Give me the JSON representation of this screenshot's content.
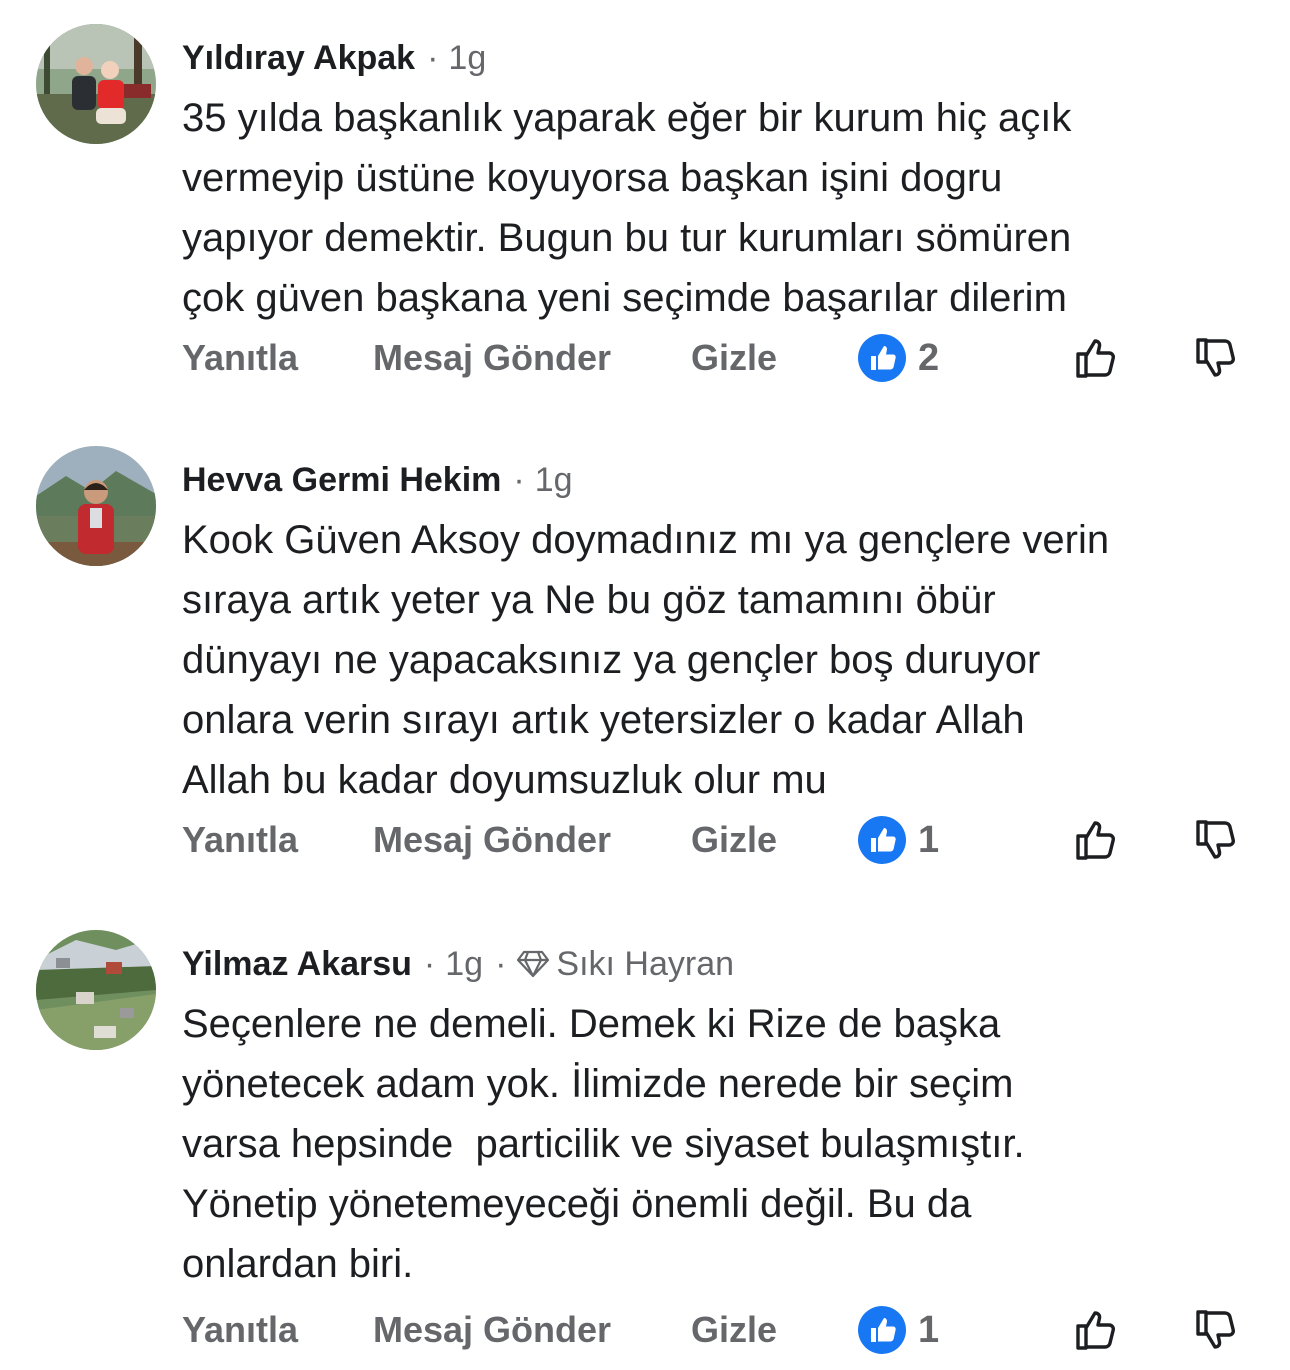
{
  "comments": [
    {
      "author": "Yıldıray Akpak",
      "time": "1g",
      "badge": "",
      "lines": [
        "35 yılda başkanlık yaparak eğer bir kurum hiç açık",
        "vermeyip üstüne koyuyorsa başkan işini dogru",
        "yapıyor demektir. Bugun bu tur kurumları sömüren",
        "çok güven başkana yeni seçimde başarılar dilerim"
      ],
      "reply_label": "Yanıtla",
      "message_label": "Mesaj Gönder",
      "hide_label": "Gizle",
      "like_count": "2"
    },
    {
      "author": "Hevva Germi Hekim",
      "time": "1g",
      "badge": "",
      "lines": [
        "Kook Güven Aksoy doymadınız mı ya gençlere verin",
        "sıraya artık yeter ya Ne bu göz tamamını öbür",
        "dünyayı ne yapacaksınız ya gençler boş duruyor",
        "onlara verin sırayı artık yetersizler o kadar Allah",
        "Allah bu kadar doyumsuzluk olur mu"
      ],
      "reply_label": "Yanıtla",
      "message_label": "Mesaj Gönder",
      "hide_label": "Gizle",
      "like_count": "1"
    },
    {
      "author": "Yilmaz Akarsu",
      "time": "1g",
      "badge": "Sıkı Hayran",
      "lines": [
        "Seçenlere ne demeli. Demek ki Rize de başka",
        "yönetecek adam yok. İlimizde nerede bir seçim",
        "varsa hepsinde  particilik ve siyaset bulaşmıştır.",
        "Yönetip yönetemeyeceği önemli değil. Bu da",
        "onlardan biri."
      ],
      "reply_label": "Yanıtla",
      "message_label": "Mesaj Gönder",
      "hide_label": "Gizle",
      "like_count": "1"
    }
  ],
  "colors": {
    "text": "#1c1e21",
    "secondary": "#65676b",
    "like_blue": "#1877f2",
    "background": "#ffffff"
  },
  "icons": {
    "separator": "dot",
    "badge": "diamond-icon",
    "reaction": "like-reaction-icon",
    "upvote": "thumbs-up-outline-icon",
    "downvote": "thumbs-down-outline-icon"
  }
}
